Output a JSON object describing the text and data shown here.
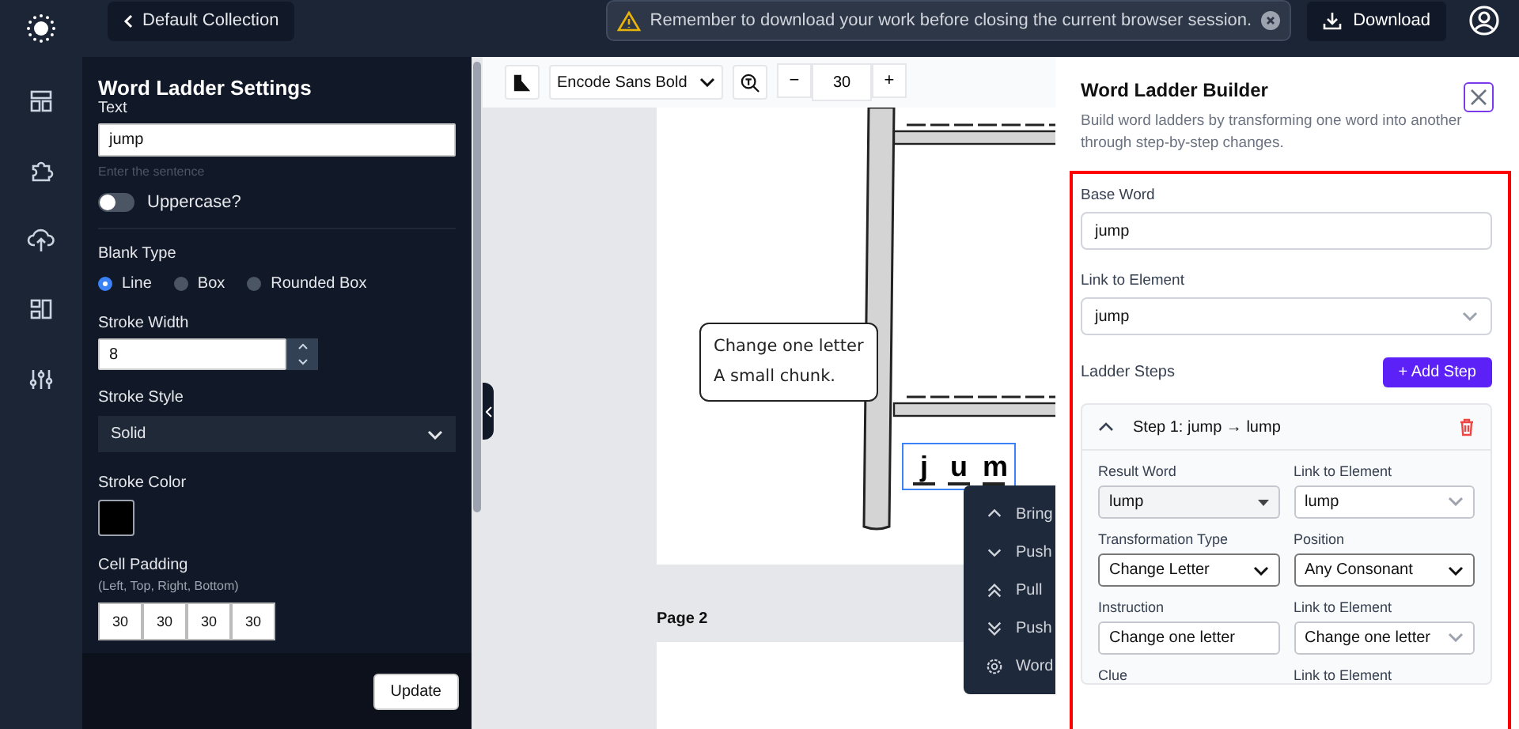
{
  "header": {
    "back_label": "Default Collection",
    "notice": "Remember to download your work before closing the current browser session.",
    "download_label": "Download"
  },
  "settings": {
    "title": "Word Ladder Settings",
    "text_label": "Text",
    "text_value": "jump",
    "text_hint": "Enter the sentence",
    "uppercase": {
      "label": "Uppercase?",
      "on": false
    },
    "blank_type": {
      "label": "Blank Type",
      "options": [
        {
          "label": "Line",
          "selected": true
        },
        {
          "label": "Box",
          "selected": false
        },
        {
          "label": "Rounded Box",
          "selected": false
        }
      ]
    },
    "stroke_width": {
      "label": "Stroke Width",
      "value": "8"
    },
    "stroke_style": {
      "label": "Stroke Style",
      "value": "Solid"
    },
    "stroke_color": {
      "label": "Stroke Color"
    },
    "cell_padding": {
      "label": "Cell Padding",
      "hint": "(Left, Top, Right, Bottom)",
      "values": [
        "30",
        "30",
        "30",
        "30"
      ]
    },
    "update_label": "Update"
  },
  "toolbar": {
    "font": "Encode Sans Bold",
    "size": "30",
    "minus": "−",
    "plus": "+"
  },
  "canvas": {
    "callout_lines": [
      "Change one letter",
      "A small chunk."
    ],
    "word_letters": [
      "j",
      "u",
      "m"
    ],
    "page2_label": "Page 2",
    "context_menu": [
      {
        "label": "Bring",
        "kind": "up"
      },
      {
        "label": "Push",
        "kind": "down"
      },
      {
        "label": "Pull",
        "kind": "top"
      },
      {
        "label": "Push",
        "kind": "bottom"
      },
      {
        "label": "Word",
        "kind": "settings"
      }
    ]
  },
  "builder": {
    "title": "Word Ladder Builder",
    "description": "Build word ladders by transforming one word into another through step-by-step changes.",
    "base_word_label": "Base Word",
    "base_word": "jump",
    "link_label": "Link to Element",
    "link_value": "jump",
    "steps_label": "Ladder Steps",
    "add_step": "+ Add Step",
    "steps": [
      {
        "title": "Step 1: jump → lump",
        "expanded": true,
        "fields": [
          {
            "label": "Result Word",
            "value": "lump",
            "kind": "combo"
          },
          {
            "label": "Link to Element",
            "value": "lump",
            "kind": "dropdown"
          },
          {
            "label": "Transformation Type",
            "value": "Change Letter",
            "kind": "select"
          },
          {
            "label": "Position",
            "value": "Any Consonant",
            "kind": "select"
          },
          {
            "label": "Instruction",
            "value": "Change one letter",
            "kind": "input"
          },
          {
            "label": "Link to Element",
            "value": "Change one letter",
            "kind": "dropdown"
          },
          {
            "label": "Clue",
            "kind": "hidden"
          },
          {
            "label": "Link to Element",
            "kind": "hidden"
          }
        ]
      }
    ]
  }
}
